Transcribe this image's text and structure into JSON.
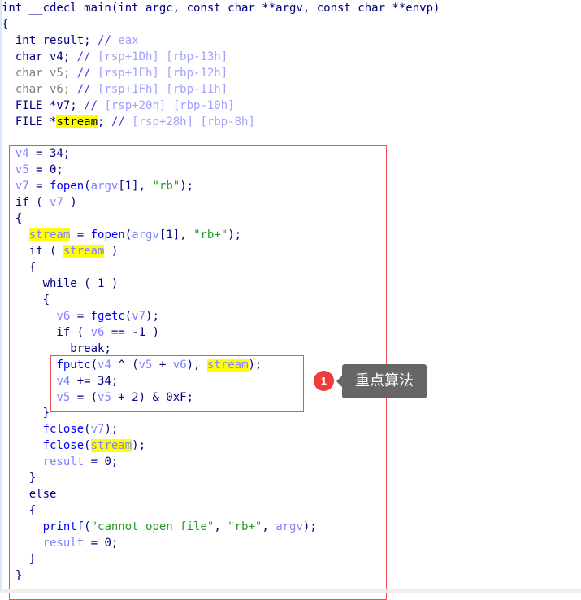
{
  "code_lines": [
    [
      [
        "int __cdecl main(int argc, const char **argv, const char **envp)",
        "k"
      ]
    ],
    [
      [
        "{",
        "k"
      ]
    ],
    [
      [
        "  int result; ",
        "k"
      ],
      [
        "//",
        "cs"
      ],
      [
        " eax",
        "c"
      ]
    ],
    [
      [
        "  char v4; ",
        "k"
      ],
      [
        "//",
        "cs"
      ],
      [
        " [rsp+1Dh] [rbp-13h]",
        "c"
      ]
    ],
    [
      [
        "  char v5; ",
        "g"
      ],
      [
        "//",
        "cs"
      ],
      [
        " [rsp+1Eh] [rbp-12h]",
        "c"
      ]
    ],
    [
      [
        "  char v6; ",
        "g"
      ],
      [
        "//",
        "cs"
      ],
      [
        " [rsp+1Fh] [rbp-11h]",
        "c"
      ]
    ],
    [
      [
        "  FILE *v7; ",
        "k"
      ],
      [
        "//",
        "cs"
      ],
      [
        " [rsp+20h] [rbp-10h]",
        "c"
      ]
    ],
    [
      [
        "  FILE *",
        "k"
      ],
      [
        "stream",
        "h"
      ],
      [
        "; ",
        "k"
      ],
      [
        "//",
        "cs"
      ],
      [
        " [rsp+28h] [rbp-8h]",
        "c"
      ]
    ],
    [],
    [
      [
        "  ",
        "k"
      ],
      [
        "v4",
        "v"
      ],
      [
        " = 34;",
        "k"
      ]
    ],
    [
      [
        "  ",
        "k"
      ],
      [
        "v5",
        "v"
      ],
      [
        " = 0;",
        "k"
      ]
    ],
    [
      [
        "  ",
        "k"
      ],
      [
        "v7",
        "v"
      ],
      [
        " = ",
        "k"
      ],
      [
        "fopen",
        "f"
      ],
      [
        "(",
        "k"
      ],
      [
        "argv",
        "v"
      ],
      [
        "[1], ",
        "k"
      ],
      [
        "\"rb\"",
        "s"
      ],
      [
        ");",
        "k"
      ]
    ],
    [
      [
        "  if ( ",
        "k"
      ],
      [
        "v7",
        "v"
      ],
      [
        " )",
        "k"
      ]
    ],
    [
      [
        "  {",
        "k"
      ]
    ],
    [
      [
        "    ",
        "k"
      ],
      [
        "stream",
        "hv"
      ],
      [
        " = ",
        "k"
      ],
      [
        "fopen",
        "f"
      ],
      [
        "(",
        "k"
      ],
      [
        "argv",
        "v"
      ],
      [
        "[1], ",
        "k"
      ],
      [
        "\"rb+\"",
        "s"
      ],
      [
        ");",
        "k"
      ]
    ],
    [
      [
        "    if ( ",
        "k"
      ],
      [
        "stream",
        "hv"
      ],
      [
        " )",
        "k"
      ]
    ],
    [
      [
        "    {",
        "k"
      ]
    ],
    [
      [
        "      while ( 1 )",
        "k"
      ]
    ],
    [
      [
        "      {",
        "k"
      ]
    ],
    [
      [
        "        ",
        "k"
      ],
      [
        "v6",
        "v"
      ],
      [
        " = ",
        "k"
      ],
      [
        "fgetc",
        "f"
      ],
      [
        "(",
        "k"
      ],
      [
        "v7",
        "v"
      ],
      [
        ");",
        "k"
      ]
    ],
    [
      [
        "        if ( ",
        "k"
      ],
      [
        "v6",
        "v"
      ],
      [
        " == -1 )",
        "k"
      ]
    ],
    [
      [
        "          break;",
        "k"
      ]
    ],
    [
      [
        "        ",
        "k"
      ],
      [
        "fputc",
        "f"
      ],
      [
        "(",
        "k"
      ],
      [
        "v4",
        "v"
      ],
      [
        " ^ (",
        "k"
      ],
      [
        "v5",
        "v"
      ],
      [
        " + ",
        "k"
      ],
      [
        "v6",
        "v"
      ],
      [
        "), ",
        "k"
      ],
      [
        "stream",
        "hv"
      ],
      [
        ");",
        "k"
      ]
    ],
    [
      [
        "        ",
        "k"
      ],
      [
        "v4",
        "v"
      ],
      [
        " += 34;",
        "k"
      ]
    ],
    [
      [
        "        ",
        "k"
      ],
      [
        "v5",
        "v"
      ],
      [
        " = (",
        "k"
      ],
      [
        "v5",
        "v"
      ],
      [
        " + 2) & 0xF;",
        "k"
      ]
    ],
    [
      [
        "      }",
        "k"
      ]
    ],
    [
      [
        "      ",
        "k"
      ],
      [
        "fclose",
        "f"
      ],
      [
        "(",
        "k"
      ],
      [
        "v7",
        "v"
      ],
      [
        ");",
        "k"
      ]
    ],
    [
      [
        "      ",
        "k"
      ],
      [
        "fclose",
        "f"
      ],
      [
        "(",
        "k"
      ],
      [
        "stream",
        "hv"
      ],
      [
        ");",
        "k"
      ]
    ],
    [
      [
        "      ",
        "k"
      ],
      [
        "result",
        "v"
      ],
      [
        " = 0;",
        "k"
      ]
    ],
    [
      [
        "    }",
        "k"
      ]
    ],
    [
      [
        "    else",
        "k"
      ]
    ],
    [
      [
        "    {",
        "k"
      ]
    ],
    [
      [
        "      ",
        "k"
      ],
      [
        "printf",
        "f"
      ],
      [
        "(",
        "k"
      ],
      [
        "\"cannot open file\"",
        "s"
      ],
      [
        ", ",
        "k"
      ],
      [
        "\"rb+\"",
        "s"
      ],
      [
        ", ",
        "k"
      ],
      [
        "argv",
        "v"
      ],
      [
        ");",
        "k"
      ]
    ],
    [
      [
        "      ",
        "k"
      ],
      [
        "result",
        "v"
      ],
      [
        " = 0;",
        "k"
      ]
    ],
    [
      [
        "    }",
        "k"
      ]
    ],
    [
      [
        "  }",
        "k"
      ]
    ]
  ],
  "annotation": {
    "badge_number": "1",
    "tooltip_text": "重点算法",
    "badge_color": "#ef3b3b",
    "box_color": "#f05050"
  }
}
